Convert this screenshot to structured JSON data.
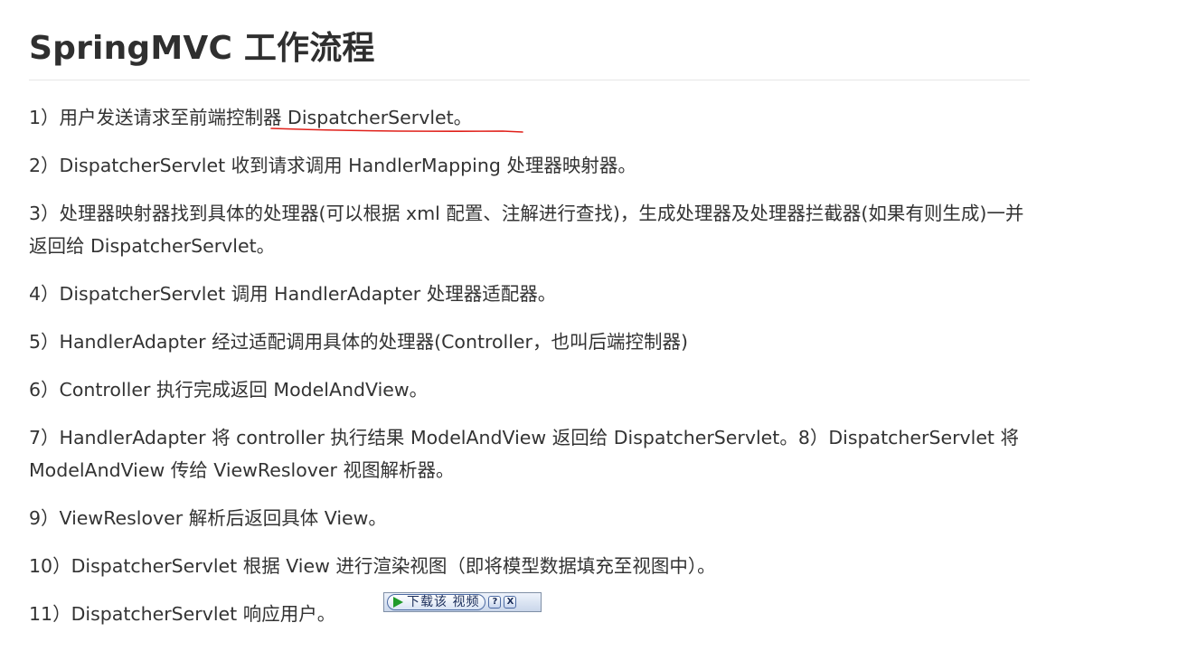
{
  "article": {
    "title": "SpringMVC 工作流程",
    "steps": [
      "1）用户发送请求至前端控制器 DispatcherServlet。",
      "2）DispatcherServlet 收到请求调用 HandlerMapping 处理器映射器。",
      "3）处理器映射器找到具体的处理器(可以根据 xml 配置、注解进行查找)，生成处理器及处理器拦截器(如果有则生成)一并返回给 DispatcherServlet。",
      "4）DispatcherServlet 调用 HandlerAdapter 处理器适配器。",
      "5）HandlerAdapter 经过适配调用具体的处理器(Controller，也叫后端控制器)",
      "6）Controller 执行完成返回 ModelAndView。",
      "7）HandlerAdapter 将 controller 执行结果 ModelAndView 返回给 DispatcherServlet。8）DispatcherServlet 将 ModelAndView 传给 ViewReslover 视图解析器。",
      "9）ViewReslover 解析后返回具体 View。",
      "10）DispatcherServlet 根据 View 进行渲染视图（即将模型数据填充至视图中）。",
      "11）DispatcherServlet 响应用户。"
    ]
  },
  "download_widget": {
    "label": "下载该 视频",
    "help": "?",
    "close": "X",
    "icon": "play-icon"
  },
  "annotation": {
    "color": "#e0201a"
  }
}
